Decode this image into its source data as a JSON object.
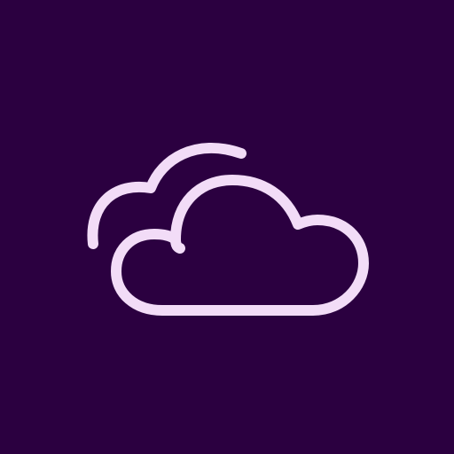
{
  "icon": {
    "name": "clouds-icon",
    "description_name": "cloudy-weather-icon"
  },
  "colors": {
    "background": "#2b0040",
    "stroke": "#f2dcf7"
  }
}
